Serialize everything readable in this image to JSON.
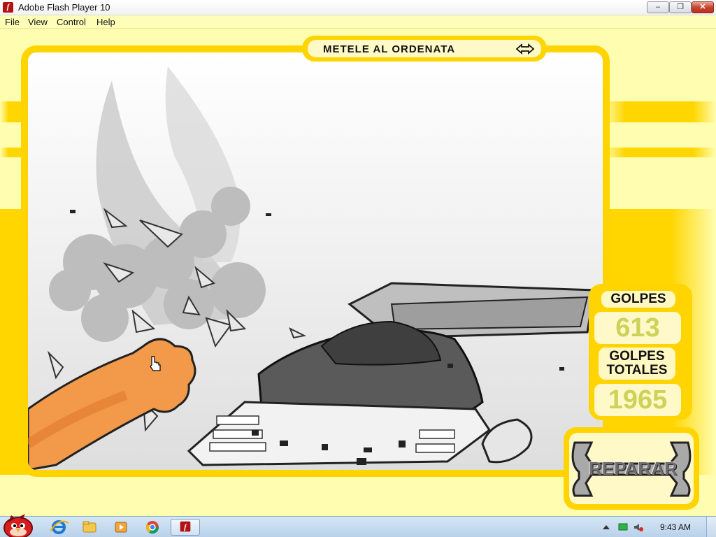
{
  "window": {
    "title": "Adobe Flash Player 10",
    "app_icon_glyph": "f",
    "controls": {
      "minimize": "‒",
      "maximize": "❐",
      "close": "✕"
    }
  },
  "menu": {
    "items": [
      "File",
      "View",
      "Control",
      "Help"
    ]
  },
  "game": {
    "title": "METELE AL ORDENATA",
    "counters": {
      "hits_label": "GOLPES",
      "hits_value": "613",
      "total_label_line1": "GOLPES",
      "total_label_line2": "TOTALES",
      "total_value": "1965"
    },
    "repair_label": "REPARAR"
  },
  "taskbar": {
    "pinned_icons": [
      "start-orb-icon",
      "internet-explorer-icon",
      "windows-explorer-icon",
      "media-player-icon",
      "chrome-icon",
      "flash-player-icon"
    ],
    "tray_icons": [
      "show-hidden-icons",
      "network-icon",
      "volume-muted-icon"
    ],
    "clock": "9:43 AM"
  },
  "colors": {
    "stage_bg": "#fffdb0",
    "accent_yellow": "#ffd400",
    "counter_value": "#cdd25a",
    "title_red": "#b31212"
  }
}
